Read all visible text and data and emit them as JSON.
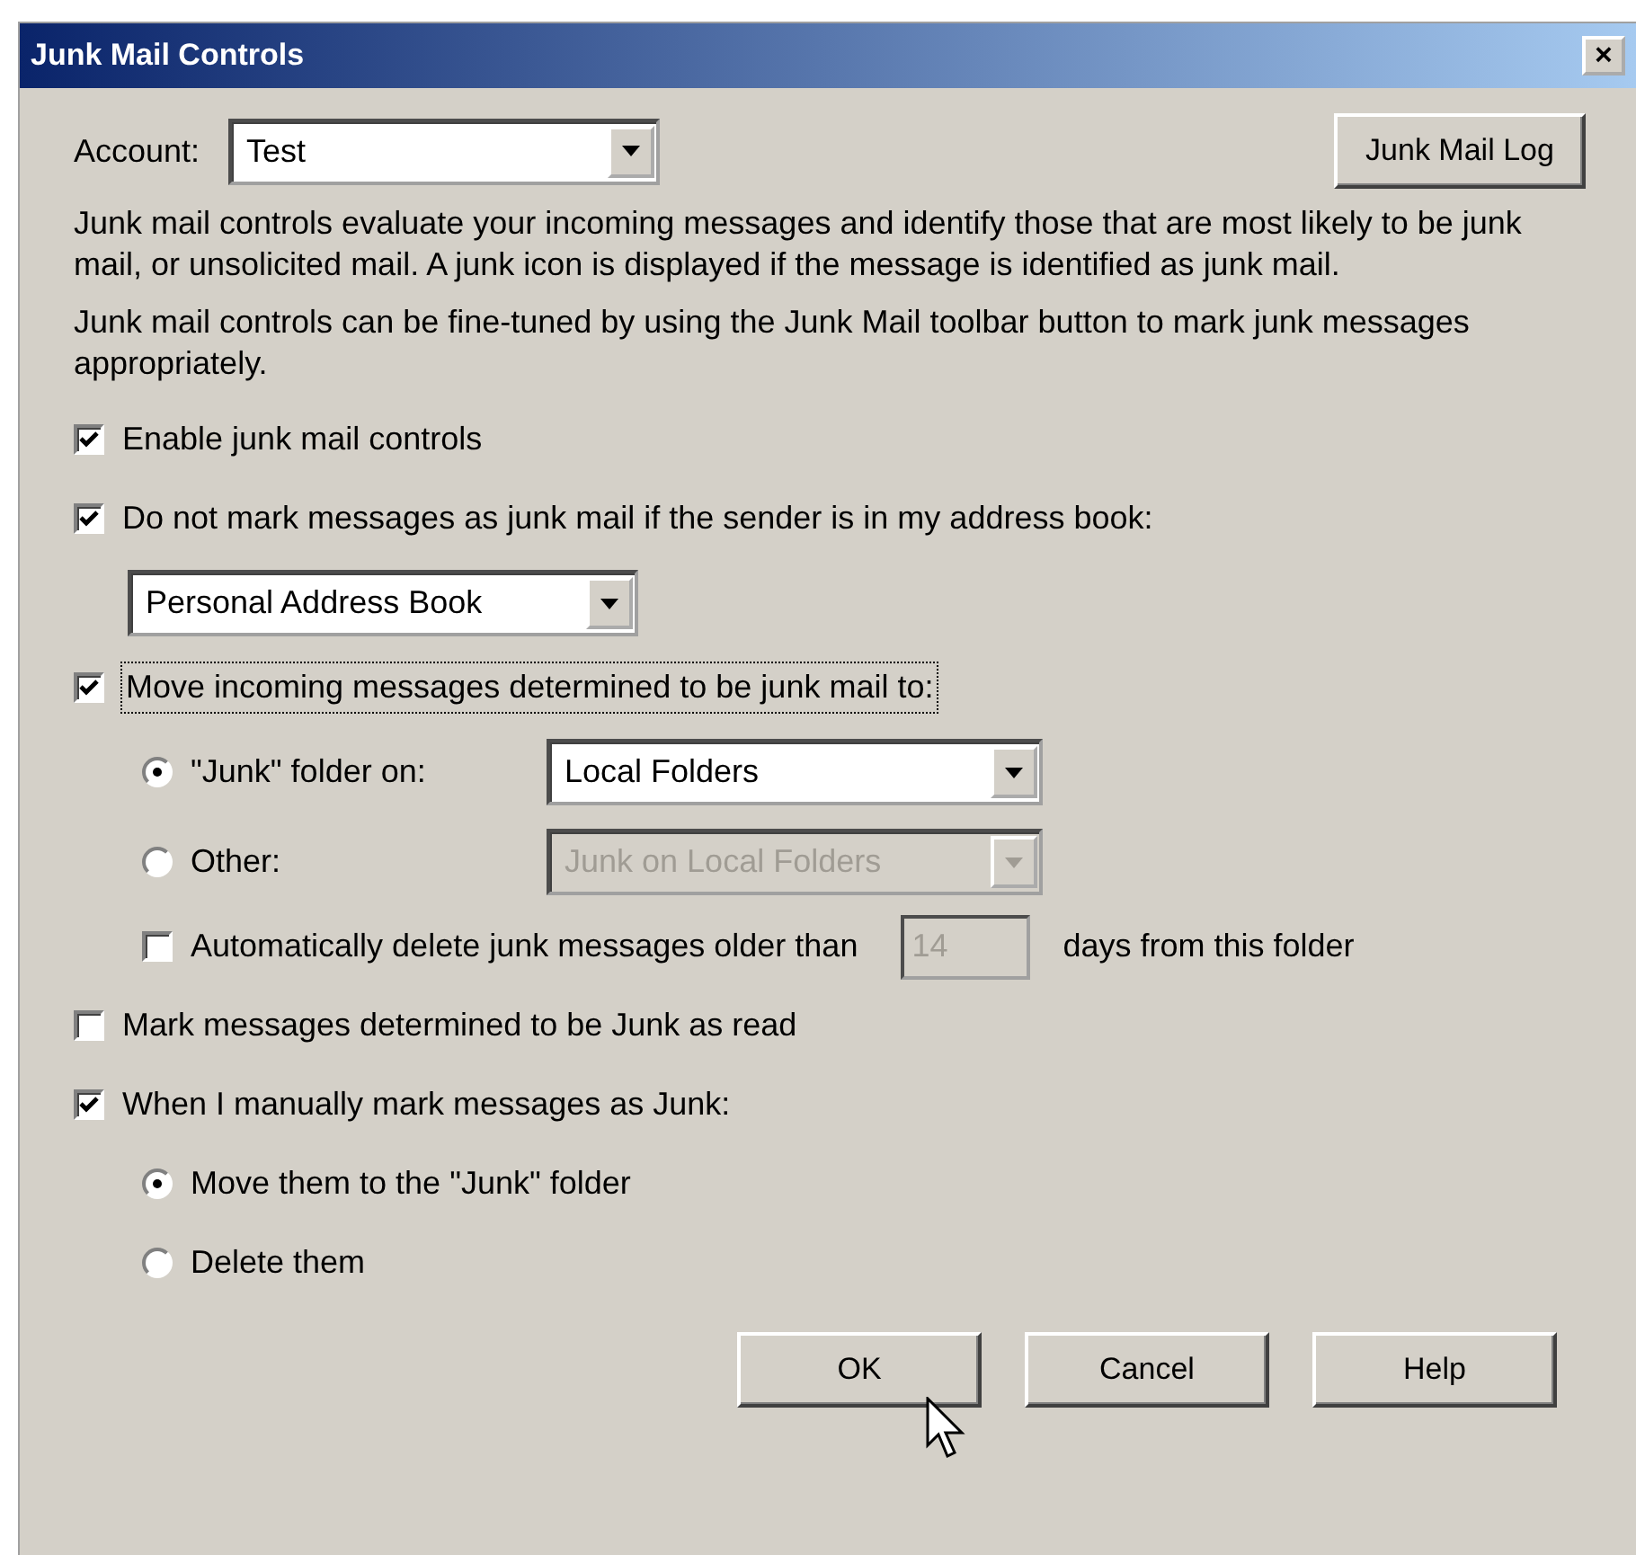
{
  "window": {
    "title": "Junk Mail Controls",
    "close": "×"
  },
  "account": {
    "label": "Account:",
    "value": "Test"
  },
  "log_button": "Junk Mail Log",
  "paragraphs": [
    "Junk mail controls evaluate your incoming messages and identify those that are most likely to be junk mail, or unsolicited mail. A junk icon is displayed if the message is identified as junk mail.",
    "Junk mail controls can be fine-tuned by using the Junk Mail toolbar button to mark junk messages appropriately."
  ],
  "options": [
    {
      "kind": "checkbox",
      "label": "Enable junk mail controls",
      "checked": true,
      "focused": false
    },
    {
      "kind": "checkbox",
      "label": "Do not mark messages as junk mail if the sender is in my address book:",
      "checked": true,
      "focused": false,
      "children": [
        {
          "kind": "select",
          "value": "Personal Address Book",
          "disabled": false
        }
      ]
    },
    {
      "kind": "checkbox",
      "label": "Move incoming messages determined to be junk mail to:",
      "checked": true,
      "focused": true,
      "children": [
        {
          "kind": "radio",
          "label": "\"Junk\" folder on:",
          "selected": true,
          "select": {
            "value": "Local Folders",
            "disabled": false
          }
        },
        {
          "kind": "radio",
          "label": "Other:",
          "selected": false,
          "select": {
            "value": "Junk on Local Folders",
            "disabled": true
          }
        },
        {
          "kind": "checkbox",
          "label": "Automatically delete junk messages older than",
          "checked": false,
          "focused": false,
          "field": {
            "value": "14",
            "disabled": true
          },
          "suffix": "days from this folder"
        }
      ]
    },
    {
      "kind": "checkbox",
      "label": "Mark messages determined to be Junk as read",
      "checked": false,
      "focused": false
    },
    {
      "kind": "checkbox",
      "label": "When I manually mark messages as Junk:",
      "checked": true,
      "focused": false,
      "children": [
        {
          "kind": "radio",
          "label": "Move them to the \"Junk\" folder",
          "selected": true
        },
        {
          "kind": "radio",
          "label": "Delete them",
          "selected": false
        }
      ]
    }
  ],
  "buttons": [
    "OK",
    "Cancel",
    "Help"
  ]
}
